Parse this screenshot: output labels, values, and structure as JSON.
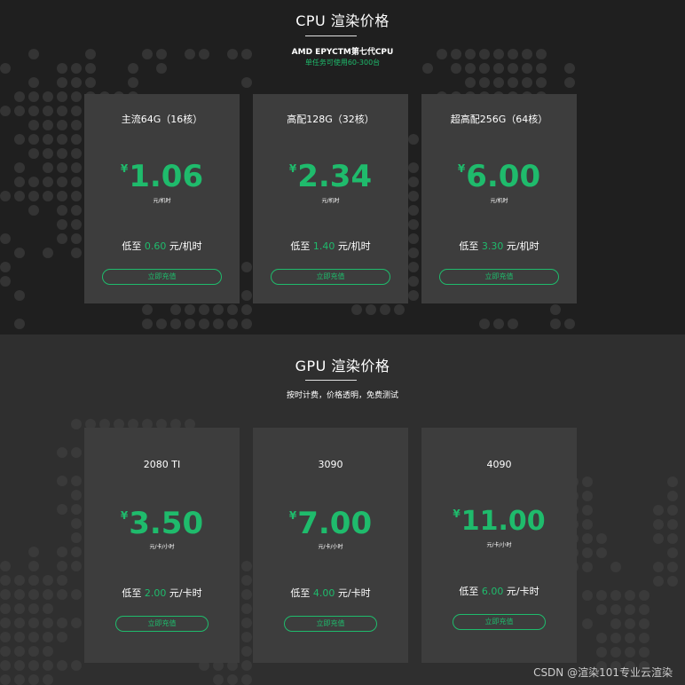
{
  "cpu": {
    "title": "CPU 渲染价格",
    "subtitle": "AMD EPYCTM第七代CPU",
    "note": "单任务可使用60-300台",
    "cards": [
      {
        "name": "主流64G（16核）",
        "currency": "¥",
        "price": "1.06",
        "unit": "元/机时",
        "low_prefix": "低至",
        "low_value": "0.60",
        "low_unit": "元/机时",
        "button": "立即充值"
      },
      {
        "name": "高配128G（32核）",
        "currency": "¥",
        "price": "2.34",
        "unit": "元/机时",
        "low_prefix": "低至",
        "low_value": "1.40",
        "low_unit": "元/机时",
        "button": "立即充值"
      },
      {
        "name": "超高配256G（64核）",
        "currency": "¥",
        "price": "6.00",
        "unit": "元/机时",
        "low_prefix": "低至",
        "low_value": "3.30",
        "low_unit": "元/机时",
        "button": "立即充值"
      }
    ]
  },
  "gpu": {
    "title": "GPU 渲染价格",
    "subtitle": "按时计费，价格透明，免费测试",
    "cards": [
      {
        "name": "2080 TI",
        "currency": "¥",
        "price": "3.50",
        "unit": "元/卡/小时",
        "low_prefix": "低至",
        "low_value": "2.00",
        "low_unit": "元/卡时",
        "button": "立即充值"
      },
      {
        "name": "3090",
        "currency": "¥",
        "price": "7.00",
        "unit": "元/卡/小时",
        "low_prefix": "低至",
        "low_value": "4.00",
        "low_unit": "元/卡时",
        "button": "立即充值"
      },
      {
        "name": "4090",
        "currency": "¥",
        "price": "11.00",
        "unit": "元/卡/小时",
        "low_prefix": "低至",
        "low_value": "6.00",
        "low_unit": "元/卡时",
        "button": "立即充值"
      }
    ]
  },
  "watermark": "CSDN @渲染101专业云渲染",
  "colors": {
    "accent": "#1fbb6c",
    "card": "#3d3d3d",
    "cpu_bg": "#1f1f1f",
    "gpu_bg": "#2f2f2f"
  }
}
